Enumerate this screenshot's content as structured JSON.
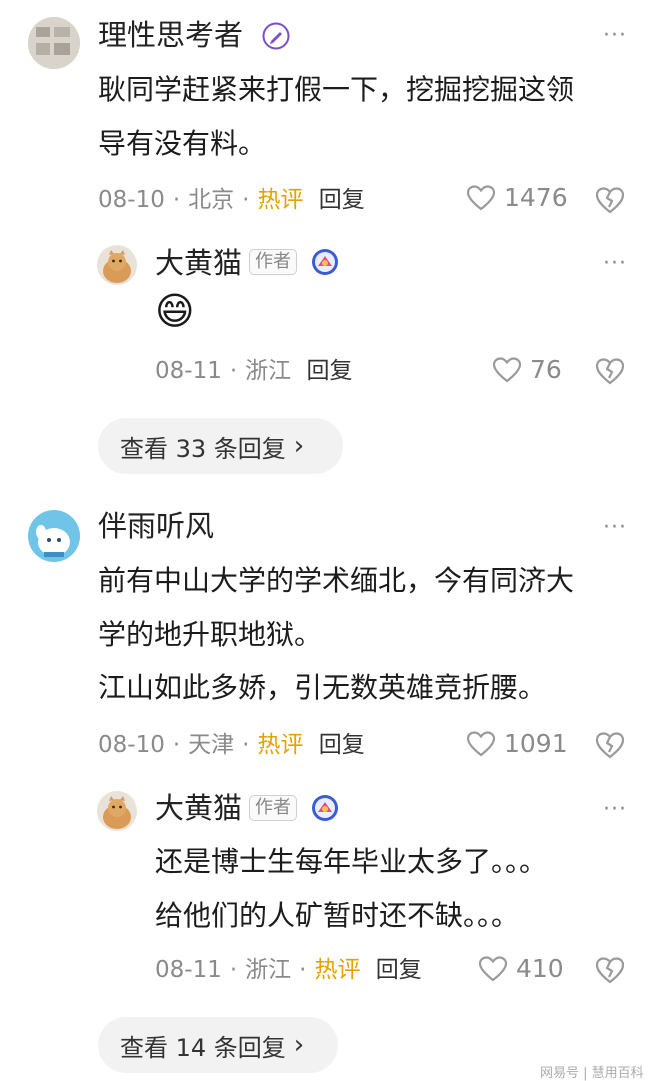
{
  "comments": [
    {
      "user": "理性思考者",
      "lines": [
        "耿同学赶紧来打假一下，挖掘挖掘这领",
        "导有没有料。"
      ],
      "date": "08-10",
      "location": "北京",
      "hot": "热评",
      "reply": "回复",
      "likes": "1476",
      "sub": {
        "user": "大黄猫",
        "badge": "作者",
        "emoji": "😄",
        "date": "08-11",
        "location": "浙江",
        "reply": "回复",
        "likes": "76"
      },
      "view_replies": "查看 33 条回复"
    },
    {
      "user": "伴雨听风",
      "lines": [
        "前有中山大学的学术缅北，今有同济大",
        "学的地升职地狱。",
        "江山如此多娇，引无数英雄竞折腰。"
      ],
      "date": "08-10",
      "location": "天津",
      "hot": "热评",
      "reply": "回复",
      "likes": "1091",
      "sub": {
        "user": "大黄猫",
        "badge": "作者",
        "lines": [
          "还是博士生每年毕业太多了。。。",
          "给他们的人矿暂时还不缺。。。"
        ],
        "date": "08-11",
        "location": "浙江",
        "hot": "热评",
        "reply": "回复",
        "likes": "410"
      },
      "view_replies": "查看 14 条回复"
    }
  ],
  "more_label": "···",
  "chevron": "›",
  "watermark": "网易号 | 慧用百科",
  "colors": {
    "hot": "#e6a100",
    "meta": "#8a8a8a",
    "pill_bg": "#f2f2f2",
    "icon": "#9a9a9a"
  }
}
